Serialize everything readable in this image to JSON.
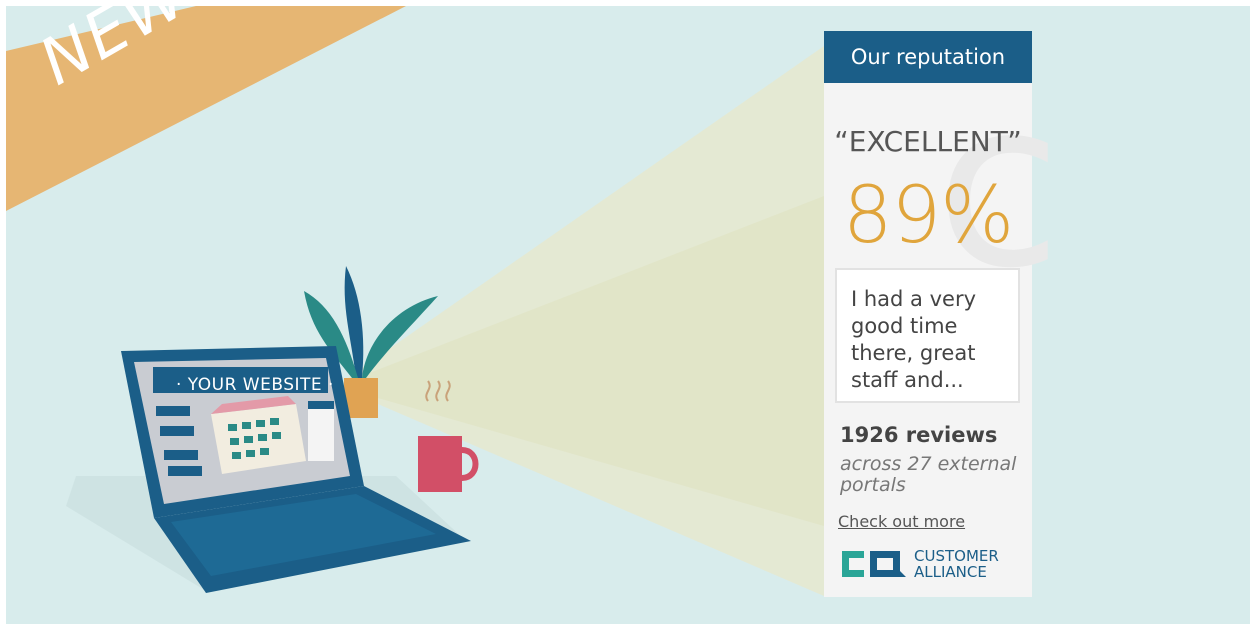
{
  "ribbon": {
    "label": "NEW"
  },
  "laptop": {
    "screen_title": "· YOUR WEBSITE ·"
  },
  "widget": {
    "header": "Our reputation",
    "rating_label": "“EXCELLENT”",
    "score": "89%",
    "review_excerpt": "I had a very good time there, great staff and...",
    "review_count": "1926 reviews",
    "portals": "across 27 external portals",
    "link": "Check out more",
    "logo_text_1": "CUSTOMER",
    "logo_text_2": "ALLIANCE"
  },
  "colors": {
    "background": "#d8ecec",
    "ribbon": "#e6b673",
    "header": "#1b5e88",
    "score": "#e0a53c",
    "laptop": "#1b5e88",
    "logo": "#2aa597"
  },
  "icons": [
    "plant-icon",
    "coffee-mug-icon",
    "customer-alliance-logo-icon"
  ]
}
